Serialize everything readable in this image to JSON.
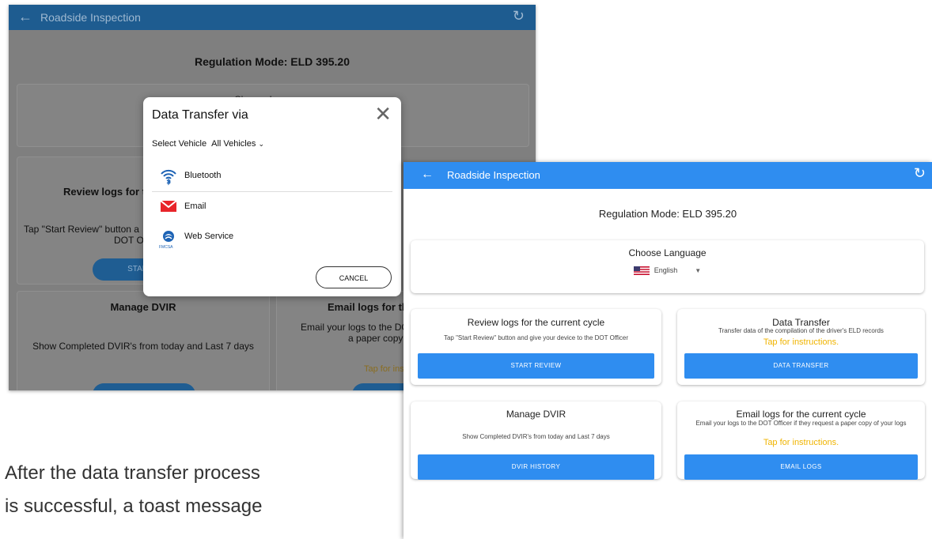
{
  "back_screen": {
    "appbar_title": "Roadside Inspection",
    "regulation": "Regulation Mode: ELD 395.20",
    "choose_language": "Choose Language",
    "review_title_partial": "Review logs for t",
    "review_text_partial": "Tap \"Start Review\" button a",
    "review_text_partial2": "DOT O",
    "start_button_partial": "START",
    "manage_dvir_title": "Manage DVIR",
    "manage_dvir_text": "Show Completed DVIR's from today and Last 7 days",
    "email_title_partial": "Email logs for th",
    "email_text_partial": "Email your logs to the DO",
    "email_text_partial2": "a paper copy",
    "instructions_partial": "Tap for ins"
  },
  "dialog": {
    "title": "Data Transfer via",
    "select_vehicle_label": "Select Vehicle",
    "select_vehicle_value": "All Vehicles",
    "options": [
      {
        "label": "Bluetooth",
        "icon": "bluetooth-wifi-icon"
      },
      {
        "label": "Email",
        "icon": "email-icon"
      },
      {
        "label": "Web Service",
        "icon": "fmcsa-icon"
      }
    ],
    "fmcsa_text": "FMCSA",
    "cancel_label": "CANCEL"
  },
  "front_screen": {
    "appbar_title": "Roadside Inspection",
    "regulation": "Regulation Mode: ELD 395.20",
    "choose_language": "Choose Language",
    "language_value": "English",
    "review": {
      "title": "Review logs for the current cycle",
      "text": "Tap \"Start Review\" button and give your device to the DOT Officer",
      "button": "START REVIEW"
    },
    "data_transfer": {
      "title": "Data Transfer",
      "text": "Transfer data of the compilation of the driver's ELD records",
      "instructions": "Tap for instructions.",
      "button": "DATA TRANSFER"
    },
    "dvir": {
      "title": "Manage DVIR",
      "text": "Show Completed DVIR's from today and Last 7 days",
      "button": "DVIR HISTORY"
    },
    "email_logs": {
      "title": "Email logs for the current cycle",
      "text": "Email your logs to the DOT Officer if they request a paper copy of your logs",
      "instructions": "Tap for instructions.",
      "button": "EMAIL LOGS"
    }
  },
  "caption": {
    "line1": "After the data transfer process",
    "line2": "is successful, a toast message"
  },
  "colors": {
    "front_accent": "#2f8df0",
    "instructions_yellow": "#f0b400",
    "email_red": "#e8242a"
  }
}
